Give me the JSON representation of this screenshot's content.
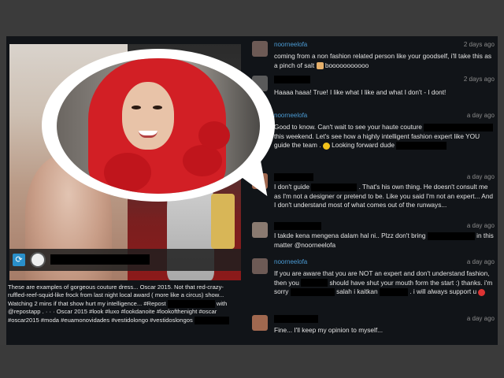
{
  "post": {
    "caption": "These are examples of gorgeous couture dress... Oscar 2015. Not that red-crazy-ruffled-reef-squid-like frock from last night local award ( more like a circus) show... Watching 2 mins if that show hurt my intelligence... #Repost",
    "caption_repost_prefix": "with",
    "caption_repost_app": "@repostapp",
    "caption_tags_1": ". · · · Oscar 2015 #look #luxo",
    "caption_tags_2": "#lookdanoite #lookofthenight #oscar #oscar2015 #moda #euamonovidades",
    "caption_tags_3": "#vestidolongo #vestidoslongos"
  },
  "comments": [
    {
      "user": "noorneelofa",
      "time": "2 days ago",
      "text": "coming from a non fashion related person like your goodself, i'll take this as a pinch of salt",
      "suffix": "booooooooooo",
      "avatar_color": "#6d5a55"
    },
    {
      "user": "",
      "time": "2 days ago",
      "text": "Haaaa haaa! True! I like what I like and what I don't - I dont!",
      "avatar_color": "#5a5a5a"
    },
    {
      "user": "noorneelofa",
      "time": "a day ago",
      "text_1": "Good to know. Can't wait to see your haute couture",
      "text_2": "this weekend. Let's see how a highly intelligent fashion expert like YOU guide the team .",
      "text_3": "Looking forward dude",
      "avatar_color": "#6d5a55"
    },
    {
      "user": "",
      "time": "a day ago",
      "text_1": "I don't guide",
      "text_2": ". That's his own thing. He doesn't consult me as I'm not a designer or pretend to be. Like you said I'm not an expert... And I don't understand most of what comes out of the runways...",
      "avatar_color": "#a0684f"
    },
    {
      "user": "",
      "time": "a day ago",
      "text_1": "I takde kena mengena dalam hal ni.. Plzz don't bring",
      "text_2": "in this matter @noorneelofa",
      "avatar_color": "#8a7a70"
    },
    {
      "user": "noorneelofa",
      "time": "a day ago",
      "text_1": "If you are aware that you are NOT an expert and don't understand fashion, then you",
      "text_2": "should have shut your mouth form the start :) thanks. i'm sorry",
      "text_3": "salah i kaitkan",
      "text_4": ". i will always support u",
      "avatar_color": "#6d5a55"
    },
    {
      "user": "",
      "time": "a day ago",
      "text": "Fine... I'll keep my opinion to myself...",
      "avatar_color": "#a0684f"
    }
  ],
  "colors": {
    "username": "#4b9bd4",
    "timestamp": "#8a8a8a",
    "background": "#111418"
  },
  "icons": {
    "repost": "repost-icon"
  }
}
